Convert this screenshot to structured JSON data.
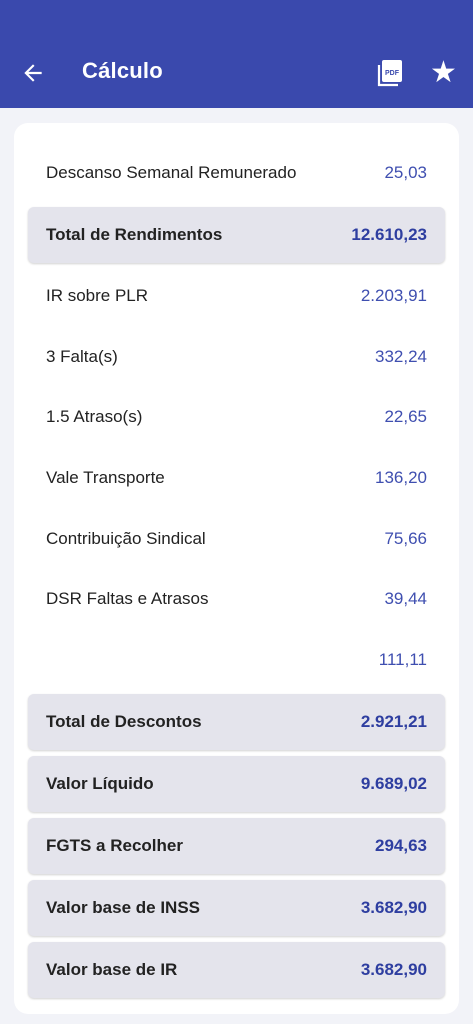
{
  "header": {
    "title": "Cálculo",
    "back_icon": "arrow-left-icon",
    "pdf_icon": "pdf-icon",
    "favorite_icon": "star-icon",
    "favorite_glyph": "★"
  },
  "rows": [
    {
      "label": "Descanso Semanal Remunerado",
      "value": "25,03"
    },
    {
      "label": "Total de Rendimentos",
      "value": "12.610,23"
    },
    {
      "label": "IR sobre PLR",
      "value": "2.203,91"
    },
    {
      "label": "3 Falta(s)",
      "value": "332,24"
    },
    {
      "label": "1.5 Atraso(s)",
      "value": "22,65"
    },
    {
      "label": "Vale Transporte",
      "value": "136,20"
    },
    {
      "label": "Contribuição Sindical",
      "value": "75,66"
    },
    {
      "label": "DSR Faltas e Atrasos",
      "value": "39,44"
    },
    {
      "label": "",
      "value": "111,11"
    },
    {
      "label": "Total de Descontos",
      "value": "2.921,21"
    },
    {
      "label": "Valor Líquido",
      "value": "9.689,02"
    },
    {
      "label": "FGTS a Recolher",
      "value": "294,63"
    },
    {
      "label": "Valor base de INSS",
      "value": "3.682,90"
    },
    {
      "label": "Valor base de IR",
      "value": "3.682,90"
    }
  ],
  "colors": {
    "appbar": "#3a49ad",
    "value_text": "#3f4fb0",
    "highlight_row": "#e4e4ec"
  }
}
